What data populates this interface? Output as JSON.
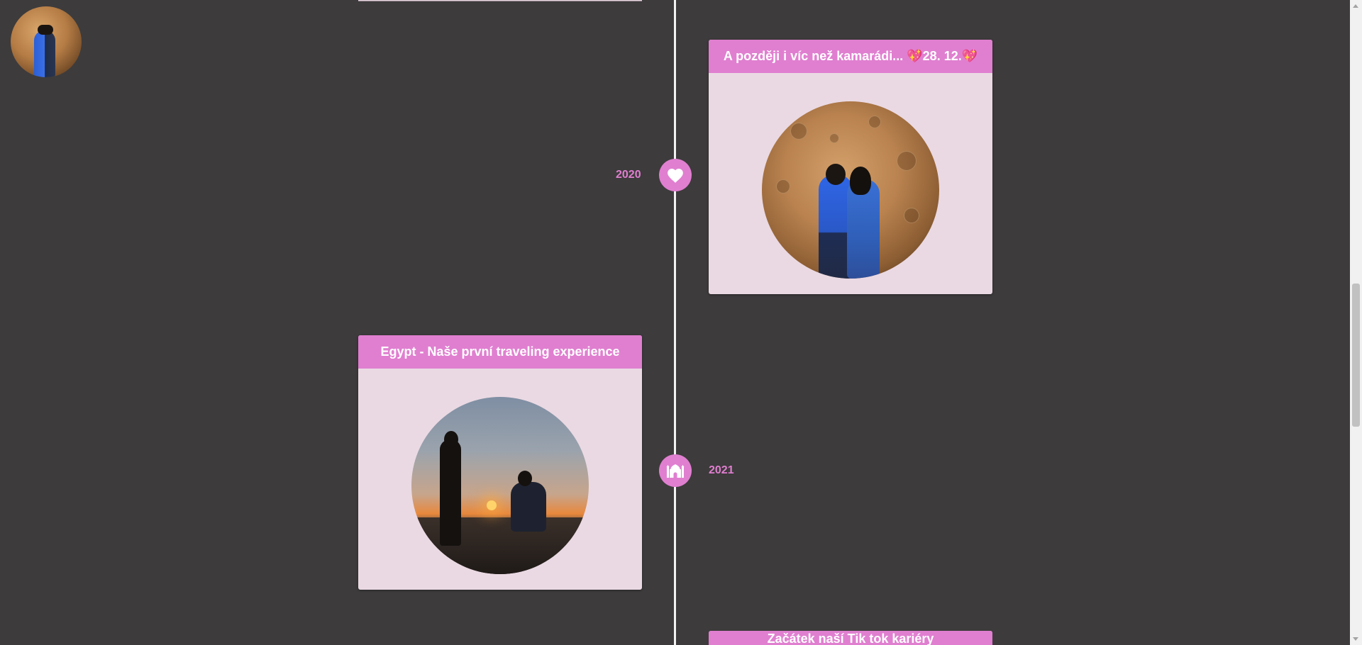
{
  "colors": {
    "background": "#3d3b3c",
    "accent": "#e07fd0",
    "card_body": "#ead9e3",
    "timeline_line": "#f2f2f2"
  },
  "avatar": {
    "icon": "profile-photo-couple-moon"
  },
  "timeline": {
    "events": [
      {
        "title": "A později i víc než kamarádi... 💖28. 12.💖",
        "year": "2020",
        "icon": "heart-icon",
        "photo": "couple-kissing-in-front-of-moon"
      },
      {
        "title": "Egypt - Naše první traveling experience",
        "year": "2021",
        "icon": "mosque-icon",
        "photo": "desert-sunset-proposal"
      },
      {
        "title": "Začátek naší Tik tok kariéry"
      }
    ]
  }
}
